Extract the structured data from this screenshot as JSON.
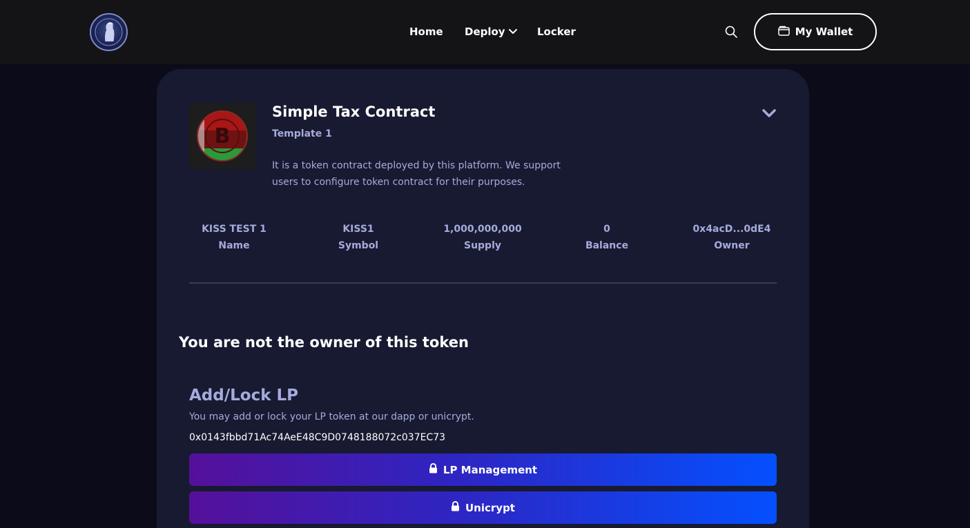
{
  "header": {
    "nav": {
      "home": "Home",
      "deploy": "Deploy",
      "locker": "Locker"
    },
    "wallet_label": "My Wallet",
    "icons": [
      "logo",
      "search-icon",
      "chevron-down-icon",
      "wallet-icon"
    ]
  },
  "token": {
    "title": "Simple Tax Contract",
    "template": "Template 1",
    "description": "It is a token contract deployed by this platform. We support users to configure token contract for their purposes.",
    "stats": [
      {
        "value": "KISS TEST 1",
        "label": "Name"
      },
      {
        "value": "KISS1",
        "label": "Symbol"
      },
      {
        "value": "1,000,000,000",
        "label": "Supply"
      },
      {
        "value": "0",
        "label": "Balance"
      },
      {
        "value": "0x4acD...0dE4",
        "label": "Owner"
      }
    ]
  },
  "ownership": {
    "message": "You are not the owner of this token"
  },
  "lp": {
    "title": "Add/Lock LP",
    "description": "You may add or lock your LP token at our dapp or unicrypt.",
    "address": "0x0143fbbd71Ac74AeE48C9D0748188072c037EC73",
    "buttons": {
      "management": "LP Management",
      "unicrypt": "Unicrypt"
    }
  },
  "colors": {
    "page_bg": "#0b0b1a",
    "topbar_bg": "#141416",
    "card_bg": "#171a30",
    "muted_text": "#a5abdc",
    "button_gradient_start": "#55109a",
    "button_gradient_end": "#0450ff"
  }
}
